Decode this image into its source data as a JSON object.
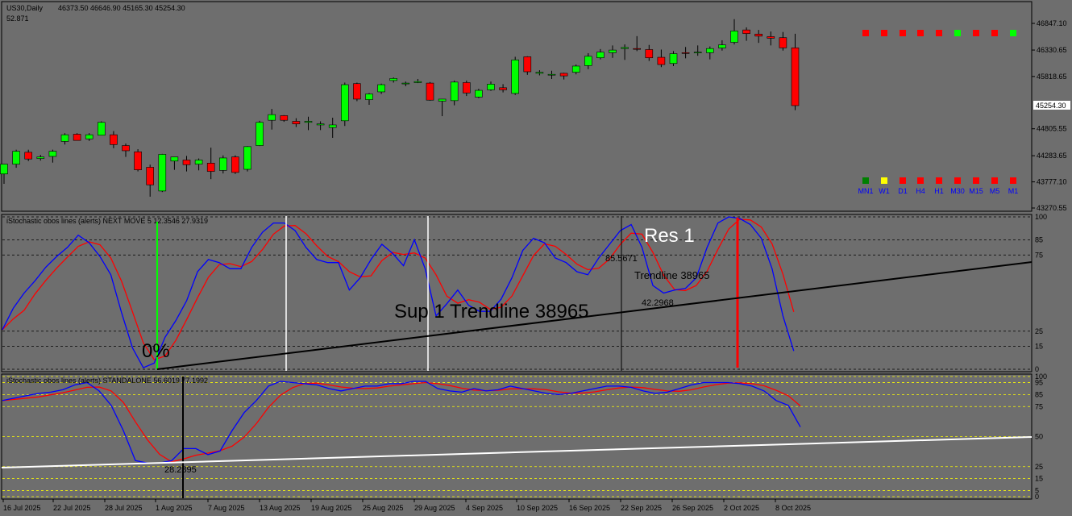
{
  "header": {
    "symbol": "US30,Daily",
    "ohlc": "46373.50 46646.90 45165.30 45254.30",
    "subvalue": "52.871"
  },
  "colors": {
    "bg": "#6e6e6e",
    "bull": "#00ff00",
    "bear": "#ff0000",
    "k_line": "#0000ff",
    "d_line": "#ff0000",
    "trendline_black": "#000000",
    "trendline_white": "#ffffff",
    "grid_dashed_black": "#000000",
    "grid_dashed_yellow": "#ffff00",
    "current_price_box_bg": "#ffffff"
  },
  "price_axis": {
    "ticks": [
      "46847.10",
      "46330.65",
      "45818.65",
      "45254.30",
      "44805.55",
      "44283.65",
      "43777.10",
      "43270.55"
    ],
    "current_price": "45254.30"
  },
  "date_axis": {
    "labels": [
      "16 Jul 2025",
      "22 Jul 2025",
      "28 Jul 2025",
      "1 Aug 2025",
      "7 Aug 2025",
      "13 Aug 2025",
      "19 Aug 2025",
      "25 Aug 2025",
      "29 Aug 2025",
      "4 Sep 2025",
      "10 Sep 2025",
      "16 Sep 2025",
      "22 Sep 2025",
      "26 Sep 2025",
      "2 Oct 2025",
      "8 Oct 2025"
    ]
  },
  "timeframe_panel": {
    "top_row_colors": [
      "red",
      "red",
      "red",
      "red",
      "red",
      "green",
      "red",
      "red",
      "green"
    ],
    "bottom_row_colors": [
      "darkgreen",
      "yellow",
      "red",
      "red",
      "red",
      "red",
      "red",
      "red",
      "red"
    ],
    "labels": [
      "MN1",
      "W1",
      "D1",
      "H4",
      "H1",
      "M30",
      "M15",
      "M5",
      "M1"
    ]
  },
  "osc1": {
    "title": "iStochastic obos lines (alerts) NEXT MOVE 5 12.3546 27.9319",
    "levels": [
      "100",
      "85",
      "75",
      "25",
      "15",
      "0"
    ],
    "annotations": {
      "zero_pct": "0%",
      "res1": "Res 1",
      "sup1": "Sup 1 Trendline 38965",
      "trendline": "Trendline 38965",
      "val_high": "85.5671",
      "val_low": "42.2968"
    }
  },
  "osc2": {
    "title": "iStochastic obos lines (alerts) STANDALONE 56.6019 77.1992",
    "levels": [
      "100",
      "95",
      "85",
      "75",
      "50",
      "25",
      "15",
      "5",
      "0"
    ],
    "annotations": {
      "low_val": "28.2895"
    }
  },
  "chart_data": [
    {
      "type": "candlestick",
      "title": "US30,Daily",
      "ylim": [
        43270.55,
        47100
      ],
      "candles": [
        [
          43930,
          44120,
          43740,
          44120
        ],
        [
          44120,
          44400,
          44050,
          44370
        ],
        [
          44350,
          44400,
          44180,
          44220
        ],
        [
          44230,
          44300,
          44190,
          44260
        ],
        [
          44270,
          44400,
          44150,
          44370
        ],
        [
          44560,
          44720,
          44500,
          44690
        ],
        [
          44700,
          44720,
          44590,
          44580
        ],
        [
          44610,
          44720,
          44570,
          44690
        ],
        [
          44680,
          44950,
          44680,
          44930
        ],
        [
          44690,
          44760,
          44430,
          44500
        ],
        [
          44480,
          44520,
          44260,
          44380
        ],
        [
          44360,
          44410,
          43980,
          44010
        ],
        [
          44060,
          44110,
          43490,
          43720
        ],
        [
          43600,
          44320,
          43580,
          44310
        ],
        [
          44180,
          44250,
          44010,
          44260
        ],
        [
          44200,
          44280,
          43980,
          44110
        ],
        [
          44120,
          44230,
          44000,
          44200
        ],
        [
          44140,
          44440,
          43830,
          43980
        ],
        [
          44000,
          44290,
          43940,
          44240
        ],
        [
          44260,
          44290,
          43930,
          43960
        ],
        [
          44020,
          44470,
          43980,
          44460
        ],
        [
          44480,
          44960,
          44470,
          44930
        ],
        [
          44970,
          45190,
          44790,
          45080
        ],
        [
          45060,
          45070,
          44940,
          44970
        ],
        [
          44950,
          45010,
          44840,
          44900
        ],
        [
          44930,
          45040,
          44780,
          44950
        ],
        [
          44880,
          44950,
          44780,
          44900
        ],
        [
          44830,
          45020,
          44630,
          44880
        ],
        [
          44960,
          45700,
          44860,
          45660
        ],
        [
          45680,
          45700,
          45340,
          45380
        ],
        [
          45370,
          45500,
          45270,
          45480
        ],
        [
          45520,
          45680,
          45480,
          45660
        ],
        [
          45740,
          45800,
          45700,
          45780
        ],
        [
          45690,
          45720,
          45630,
          45690
        ],
        [
          45700,
          45770,
          45690,
          45720
        ],
        [
          45690,
          45710,
          45350,
          45360
        ],
        [
          45340,
          45380,
          45050,
          45380
        ],
        [
          45350,
          45740,
          45260,
          45710
        ],
        [
          45700,
          45740,
          45440,
          45500
        ],
        [
          45420,
          45580,
          45400,
          45550
        ],
        [
          45560,
          45720,
          45540,
          45670
        ],
        [
          45600,
          45670,
          45510,
          45560
        ],
        [
          45490,
          46200,
          45460,
          46140
        ],
        [
          46200,
          46210,
          45850,
          45910
        ],
        [
          45880,
          45940,
          45840,
          45900
        ],
        [
          45860,
          45930,
          45770,
          45860
        ],
        [
          45880,
          45890,
          45760,
          45830
        ],
        [
          45900,
          46050,
          45860,
          46020
        ],
        [
          46030,
          46270,
          45960,
          46210
        ],
        [
          46180,
          46350,
          46150,
          46290
        ],
        [
          46280,
          46420,
          46180,
          46330
        ],
        [
          46360,
          46440,
          46140,
          46380
        ],
        [
          46360,
          46600,
          46310,
          46350
        ],
        [
          46340,
          46430,
          46120,
          46180
        ],
        [
          46190,
          46340,
          46000,
          46050
        ],
        [
          46070,
          46310,
          46020,
          46260
        ],
        [
          46280,
          46390,
          46170,
          46270
        ],
        [
          46280,
          46420,
          46220,
          46290
        ],
        [
          46280,
          46400,
          46150,
          46360
        ],
        [
          46370,
          46520,
          46320,
          46430
        ],
        [
          46480,
          46930,
          46440,
          46700
        ],
        [
          46720,
          46770,
          46510,
          46650
        ],
        [
          46640,
          46720,
          46470,
          46600
        ],
        [
          46590,
          46690,
          46420,
          46560
        ],
        [
          46570,
          46680,
          46320,
          46373.5
        ],
        [
          46373.5,
          46646.9,
          45165.3,
          45254.3
        ]
      ]
    },
    {
      "type": "line",
      "title": "iStochastic obos lines (alerts) NEXT MOVE 5",
      "ylim": [
        0,
        100
      ],
      "series": [
        {
          "name": "K",
          "values": [
            26,
            40,
            50,
            58,
            67,
            74,
            80,
            88,
            83,
            74,
            62,
            37,
            14,
            1,
            4,
            21,
            32,
            45,
            64,
            72,
            70,
            66,
            66,
            80,
            90,
            96,
            96,
            91,
            80,
            72,
            70,
            70,
            52,
            60,
            72,
            82,
            76,
            68,
            85,
            66,
            35,
            43,
            52,
            42,
            38,
            38,
            46,
            60,
            78,
            86,
            83,
            73,
            70,
            64,
            62,
            73,
            82,
            91,
            95,
            80,
            55,
            50,
            52,
            53,
            60,
            80,
            96,
            100,
            99,
            95,
            86,
            66,
            35,
            12
          ]
        },
        {
          "name": "D",
          "values": null
        }
      ]
    },
    {
      "type": "line",
      "title": "iStochastic obos lines (alerts) STANDALONE",
      "ylim": [
        0,
        100
      ],
      "series": [
        {
          "name": "K",
          "values": [
            80,
            82,
            84,
            86,
            87,
            89,
            93,
            95,
            88,
            76,
            55,
            30,
            28,
            28,
            30,
            40,
            40,
            35,
            38,
            55,
            70,
            80,
            92,
            96,
            95,
            94,
            93,
            90,
            88,
            90,
            92,
            92,
            94,
            94,
            96,
            96,
            90,
            88,
            87,
            90,
            88,
            89,
            92,
            90,
            88,
            86,
            85,
            86,
            88,
            90,
            92,
            92,
            91,
            88,
            86,
            87,
            90,
            93,
            95,
            95,
            95,
            94,
            92,
            88,
            80,
            76,
            58
          ]
        }
      ]
    }
  ]
}
